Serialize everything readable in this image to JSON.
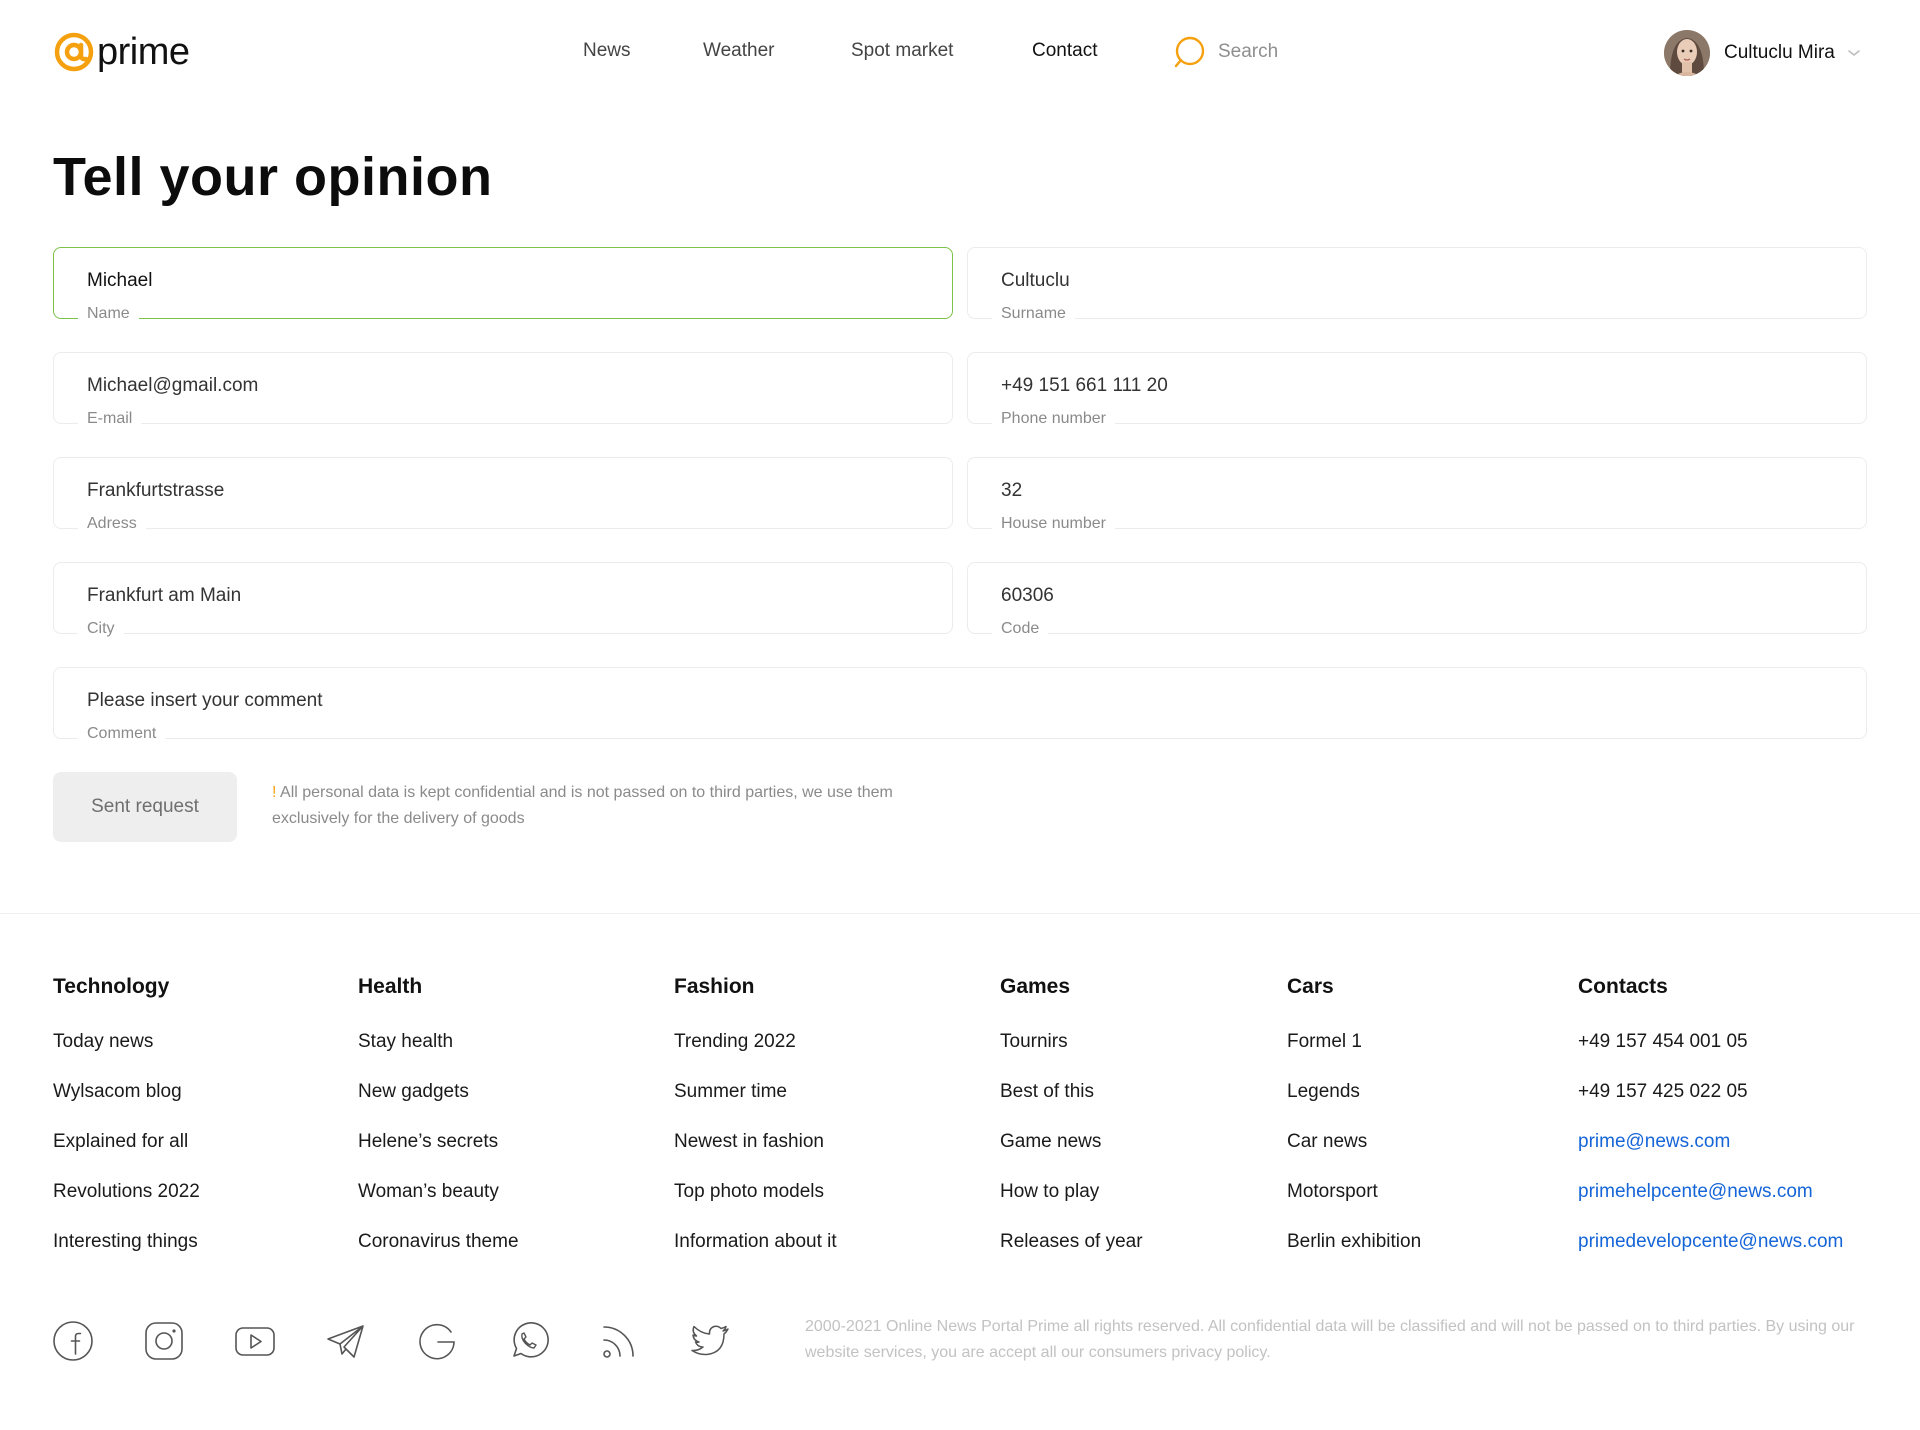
{
  "header": {
    "logo_text": "prime",
    "nav": [
      {
        "label": "News"
      },
      {
        "label": "Weather"
      },
      {
        "label": "Spot market"
      },
      {
        "label": "Contact"
      }
    ],
    "search_label": "Search",
    "user_name": "Cultuclu Mira"
  },
  "page": {
    "title": "Tell your opinion"
  },
  "form": {
    "name": {
      "value": "Michael",
      "label": "Name"
    },
    "surname": {
      "value": "Cultuclu",
      "label": "Surname"
    },
    "email": {
      "value": "Michael@gmail.com",
      "label": "E-mail"
    },
    "phone": {
      "value": "+49 151 661 111 20",
      "label": "Phone number"
    },
    "address": {
      "value": "Frankfurtstrasse",
      "label": "Adress"
    },
    "house": {
      "value": "32",
      "label": "House number"
    },
    "city": {
      "value": "Frankfurt am Main",
      "label": "City"
    },
    "code": {
      "value": "60306",
      "label": "Code"
    },
    "comment": {
      "placeholder": "Please insert your comment",
      "label": "Comment"
    },
    "submit_label": "Sent request",
    "note_mark": "!",
    "note_text": " All personal data is kept confidential and is not passed on to third parties, we use them exclusively for the delivery of goods"
  },
  "footer": {
    "columns": [
      {
        "title": "Technology",
        "items": [
          "Today news",
          "Wylsacom blog",
          "Explained for all",
          "Revolutions 2022",
          "Interesting things"
        ]
      },
      {
        "title": "Health",
        "items": [
          "Stay health",
          "New gadgets",
          "Helene’s secrets",
          "Woman’s beauty",
          "Coronavirus theme"
        ]
      },
      {
        "title": "Fashion",
        "items": [
          "Trending 2022",
          "Summer time",
          "Newest in fashion",
          "Top photo models",
          "Information about it"
        ]
      },
      {
        "title": "Games",
        "items": [
          "Tournirs",
          "Best of this",
          "Game news",
          "How to play",
          "Releases of year"
        ]
      },
      {
        "title": "Cars",
        "items": [
          "Formel 1",
          "Legends",
          "Car news",
          "Motorsport",
          "Berlin exhibition"
        ]
      },
      {
        "title": "Contacts",
        "items": [
          "+49 157 454 001 05",
          "+49 157 425 022 05",
          "prime@news.com",
          "primehelpcente@news.com",
          "primedevelopcente@news.com"
        ]
      }
    ],
    "socials": [
      "facebook-icon",
      "instagram-icon",
      "youtube-icon",
      "telegram-icon",
      "google-icon",
      "whatsapp-icon",
      "rss-icon",
      "twitter-icon"
    ],
    "copyright": "2000-2021 Online News Portal Prime all rights reserved. All confidential data will be classified and will not be passed on to third parties. By using our website services, you are accept all our consumers privacy policy."
  },
  "colors": {
    "accent": "#f5a10f",
    "focus_border": "#7cc24a",
    "link": "#1565d8"
  }
}
